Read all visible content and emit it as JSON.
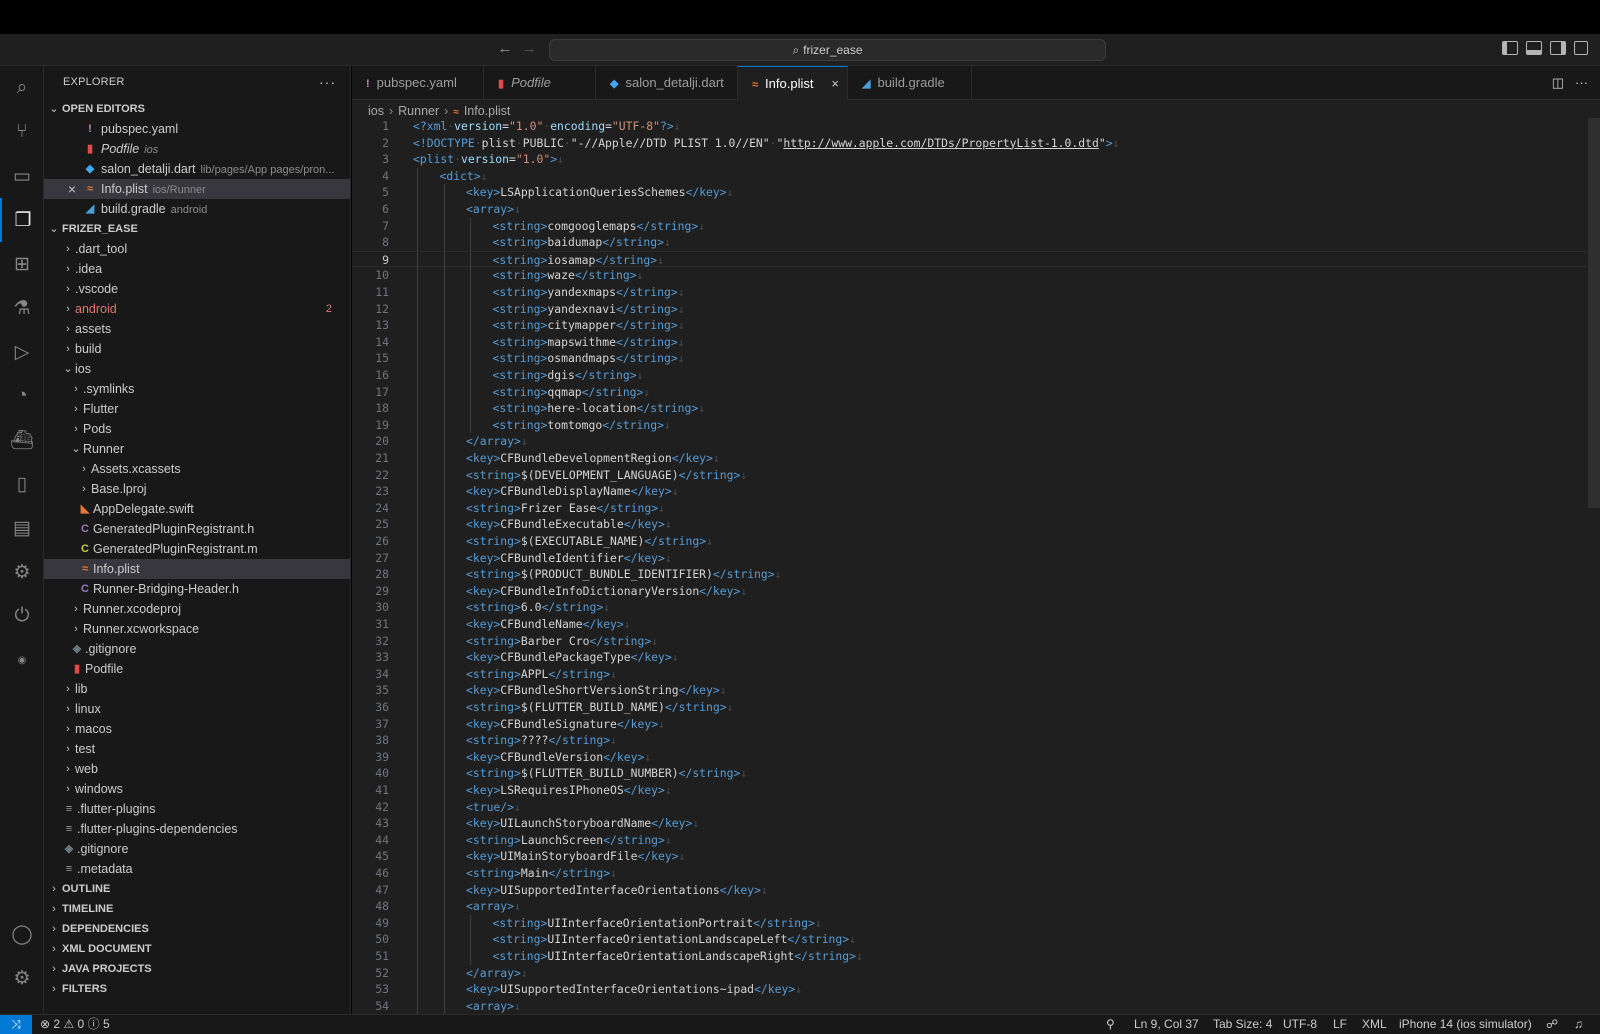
{
  "titlebar": {
    "search_text": "frizer_ease"
  },
  "explorer": {
    "title": "EXPLORER",
    "open_editors_label": "OPEN EDITORS",
    "open_editors": [
      {
        "name": "pubspec.yaml",
        "desc": "",
        "icon": "!",
        "icon_color": "#c586c0",
        "italic": false
      },
      {
        "name": "Podfile",
        "desc": "ios",
        "icon": "▮",
        "icon_color": "#e14b4b",
        "italic": true
      },
      {
        "name": "salon_detalji.dart",
        "desc": "lib/pages/App pages/pron...",
        "icon": "◆",
        "icon_color": "#42a5f5",
        "italic": false
      },
      {
        "name": "Info.plist",
        "desc": "ios/Runner",
        "icon": "≈",
        "icon_color": "#e37933",
        "italic": false
      },
      {
        "name": "build.gradle",
        "desc": "android",
        "icon": "◢",
        "icon_color": "#4a9fd4",
        "italic": false
      }
    ],
    "project_label": "FRIZER_EASE",
    "tree": [
      {
        "name": ".dart_tool",
        "type": "folder",
        "depth": 0,
        "open": false
      },
      {
        "name": ".idea",
        "type": "folder",
        "depth": 0,
        "open": false
      },
      {
        "name": ".vscode",
        "type": "folder",
        "depth": 0,
        "open": false
      },
      {
        "name": "android",
        "type": "folder",
        "depth": 0,
        "open": false,
        "badge": "2",
        "error": true
      },
      {
        "name": "assets",
        "type": "folder",
        "depth": 0,
        "open": false
      },
      {
        "name": "build",
        "type": "folder",
        "depth": 0,
        "open": false
      },
      {
        "name": "ios",
        "type": "folder",
        "depth": 0,
        "open": true
      },
      {
        "name": ".symlinks",
        "type": "folder",
        "depth": 1,
        "open": false
      },
      {
        "name": "Flutter",
        "type": "folder",
        "depth": 1,
        "open": false
      },
      {
        "name": "Pods",
        "type": "folder",
        "depth": 1,
        "open": false
      },
      {
        "name": "Runner",
        "type": "folder",
        "depth": 1,
        "open": true
      },
      {
        "name": "Assets.xcassets",
        "type": "folder",
        "depth": 2,
        "open": false
      },
      {
        "name": "Base.lproj",
        "type": "folder",
        "depth": 2,
        "open": false
      },
      {
        "name": "AppDelegate.swift",
        "type": "file",
        "depth": 2,
        "icon": "◣",
        "icon_color": "#e37933"
      },
      {
        "name": "GeneratedPluginRegistrant.h",
        "type": "file",
        "depth": 2,
        "icon": "C",
        "icon_color": "#a074c4"
      },
      {
        "name": "GeneratedPluginRegistrant.m",
        "type": "file",
        "depth": 2,
        "icon": "C",
        "icon_color": "#cbcb41"
      },
      {
        "name": "Info.plist",
        "type": "file",
        "depth": 2,
        "icon": "≈",
        "icon_color": "#e37933",
        "selected": true
      },
      {
        "name": "Runner-Bridging-Header.h",
        "type": "file",
        "depth": 2,
        "icon": "C",
        "icon_color": "#a074c4"
      },
      {
        "name": "Runner.xcodeproj",
        "type": "folder",
        "depth": 1,
        "open": false
      },
      {
        "name": "Runner.xcworkspace",
        "type": "folder",
        "depth": 1,
        "open": false
      },
      {
        "name": ".gitignore",
        "type": "file",
        "depth": 1,
        "icon": "◈",
        "icon_color": "#6d8086"
      },
      {
        "name": "Podfile",
        "type": "file",
        "depth": 1,
        "icon": "▮",
        "icon_color": "#e14b4b"
      },
      {
        "name": "lib",
        "type": "folder",
        "depth": 0,
        "open": false
      },
      {
        "name": "linux",
        "type": "folder",
        "depth": 0,
        "open": false
      },
      {
        "name": "macos",
        "type": "folder",
        "depth": 0,
        "open": false
      },
      {
        "name": "test",
        "type": "folder",
        "depth": 0,
        "open": false
      },
      {
        "name": "web",
        "type": "folder",
        "depth": 0,
        "open": false
      },
      {
        "name": "windows",
        "type": "folder",
        "depth": 0,
        "open": false
      },
      {
        "name": ".flutter-plugins",
        "type": "file",
        "depth": 0,
        "icon": "≡",
        "icon_color": "#9d9d9d"
      },
      {
        "name": ".flutter-plugins-dependencies",
        "type": "file",
        "depth": 0,
        "icon": "≡",
        "icon_color": "#9d9d9d"
      },
      {
        "name": ".gitignore",
        "type": "file",
        "depth": 0,
        "icon": "◈",
        "icon_color": "#6d8086"
      },
      {
        "name": ".metadata",
        "type": "file",
        "depth": 0,
        "icon": "≡",
        "icon_color": "#9d9d9d"
      }
    ],
    "sections": [
      "OUTLINE",
      "TIMELINE",
      "DEPENDENCIES",
      "XML DOCUMENT",
      "JAVA PROJECTS",
      "FILTERS"
    ]
  },
  "tabs": [
    {
      "label": "pubspec.yaml",
      "icon": "!",
      "icon_color": "#c586c0",
      "active": false,
      "italic": false
    },
    {
      "label": "Podfile",
      "icon": "▮",
      "icon_color": "#e14b4b",
      "active": false,
      "italic": true
    },
    {
      "label": "salon_detalji.dart",
      "icon": "◆",
      "icon_color": "#42a5f5",
      "active": false,
      "italic": false
    },
    {
      "label": "Info.plist",
      "icon": "≈",
      "icon_color": "#e37933",
      "active": true,
      "italic": false
    },
    {
      "label": "build.gradle",
      "icon": "◢",
      "icon_color": "#4a9fd4",
      "active": false,
      "italic": false
    }
  ],
  "breadcrumb": [
    "ios",
    "Runner",
    "Info.plist"
  ],
  "editor": {
    "current_line": 9,
    "lines": [
      {
        "n": "1",
        "indent": 0,
        "kind": "xmldecl"
      },
      {
        "n": "2",
        "indent": 0,
        "kind": "doctype",
        "public_id": "\"-//Apple//DTD PLIST 1.0//EN\"",
        "system_id": "http://www.apple.com/DTDs/PropertyList-1.0.dtd"
      },
      {
        "n": "3",
        "indent": 0,
        "kind": "plist"
      },
      {
        "n": "4",
        "indent": 1,
        "kind": "open",
        "tag": "dict"
      },
      {
        "n": "5",
        "indent": 2,
        "kind": "elem",
        "tag": "key",
        "text": "LSApplicationQueriesSchemes"
      },
      {
        "n": "6",
        "indent": 2,
        "kind": "open",
        "tag": "array"
      },
      {
        "n": "7",
        "indent": 3,
        "kind": "elem",
        "tag": "string",
        "text": "comgooglemaps"
      },
      {
        "n": "8",
        "indent": 3,
        "kind": "elem",
        "tag": "string",
        "text": "baidumap"
      },
      {
        "n": "9",
        "indent": 3,
        "kind": "elem",
        "tag": "string",
        "text": "iosamap"
      },
      {
        "n": "10",
        "indent": 3,
        "kind": "elem",
        "tag": "string",
        "text": "waze"
      },
      {
        "n": "11",
        "indent": 3,
        "kind": "elem",
        "tag": "string",
        "text": "yandexmaps"
      },
      {
        "n": "12",
        "indent": 3,
        "kind": "elem",
        "tag": "string",
        "text": "yandexnavi"
      },
      {
        "n": "13",
        "indent": 3,
        "kind": "elem",
        "tag": "string",
        "text": "citymapper"
      },
      {
        "n": "14",
        "indent": 3,
        "kind": "elem",
        "tag": "string",
        "text": "mapswithme"
      },
      {
        "n": "15",
        "indent": 3,
        "kind": "elem",
        "tag": "string",
        "text": "osmandmaps"
      },
      {
        "n": "16",
        "indent": 3,
        "kind": "elem",
        "tag": "string",
        "text": "dgis"
      },
      {
        "n": "17",
        "indent": 3,
        "kind": "elem",
        "tag": "string",
        "text": "qqmap"
      },
      {
        "n": "18",
        "indent": 3,
        "kind": "elem",
        "tag": "string",
        "text": "here-location"
      },
      {
        "n": "19",
        "indent": 3,
        "kind": "elem",
        "tag": "string",
        "text": "tomtomgo"
      },
      {
        "n": "20",
        "indent": 2,
        "kind": "close",
        "tag": "array"
      },
      {
        "n": "21",
        "indent": 2,
        "kind": "elem",
        "tag": "key",
        "text": "CFBundleDevelopmentRegion"
      },
      {
        "n": "22",
        "indent": 2,
        "kind": "elem",
        "tag": "string",
        "text": "$(DEVELOPMENT_LANGUAGE)"
      },
      {
        "n": "23",
        "indent": 2,
        "kind": "elem",
        "tag": "key",
        "text": "CFBundleDisplayName"
      },
      {
        "n": "24",
        "indent": 2,
        "kind": "elem",
        "tag": "string",
        "text": "Frizer Ease"
      },
      {
        "n": "25",
        "indent": 2,
        "kind": "elem",
        "tag": "key",
        "text": "CFBundleExecutable"
      },
      {
        "n": "26",
        "indent": 2,
        "kind": "elem",
        "tag": "string",
        "text": "$(EXECUTABLE_NAME)"
      },
      {
        "n": "27",
        "indent": 2,
        "kind": "elem",
        "tag": "key",
        "text": "CFBundleIdentifier"
      },
      {
        "n": "28",
        "indent": 2,
        "kind": "elem",
        "tag": "string",
        "text": "$(PRODUCT_BUNDLE_IDENTIFIER)"
      },
      {
        "n": "29",
        "indent": 2,
        "kind": "elem",
        "tag": "key",
        "text": "CFBundleInfoDictionaryVersion"
      },
      {
        "n": "30",
        "indent": 2,
        "kind": "elem",
        "tag": "string",
        "text": "6.0"
      },
      {
        "n": "31",
        "indent": 2,
        "kind": "elem",
        "tag": "key",
        "text": "CFBundleName"
      },
      {
        "n": "32",
        "indent": 2,
        "kind": "elem",
        "tag": "string",
        "text": "Barber Cro"
      },
      {
        "n": "33",
        "indent": 2,
        "kind": "elem",
        "tag": "key",
        "text": "CFBundlePackageType"
      },
      {
        "n": "34",
        "indent": 2,
        "kind": "elem",
        "tag": "string",
        "text": "APPL"
      },
      {
        "n": "35",
        "indent": 2,
        "kind": "elem",
        "tag": "key",
        "text": "CFBundleShortVersionString"
      },
      {
        "n": "36",
        "indent": 2,
        "kind": "elem",
        "tag": "string",
        "text": "$(FLUTTER_BUILD_NAME)"
      },
      {
        "n": "37",
        "indent": 2,
        "kind": "elem",
        "tag": "key",
        "text": "CFBundleSignature"
      },
      {
        "n": "38",
        "indent": 2,
        "kind": "elem",
        "tag": "string",
        "text": "????"
      },
      {
        "n": "39",
        "indent": 2,
        "kind": "elem",
        "tag": "key",
        "text": "CFBundleVersion"
      },
      {
        "n": "40",
        "indent": 2,
        "kind": "elem",
        "tag": "string",
        "text": "$(FLUTTER_BUILD_NUMBER)"
      },
      {
        "n": "41",
        "indent": 2,
        "kind": "elem",
        "tag": "key",
        "text": "LSRequiresIPhoneOS"
      },
      {
        "n": "42",
        "indent": 2,
        "kind": "selfclose",
        "tag": "true"
      },
      {
        "n": "43",
        "indent": 2,
        "kind": "elem",
        "tag": "key",
        "text": "UILaunchStoryboardName"
      },
      {
        "n": "44",
        "indent": 2,
        "kind": "elem",
        "tag": "string",
        "text": "LaunchScreen"
      },
      {
        "n": "45",
        "indent": 2,
        "kind": "elem",
        "tag": "key",
        "text": "UIMainStoryboardFile"
      },
      {
        "n": "46",
        "indent": 2,
        "kind": "elem",
        "tag": "string",
        "text": "Main"
      },
      {
        "n": "47",
        "indent": 2,
        "kind": "elem",
        "tag": "key",
        "text": "UISupportedInterfaceOrientations"
      },
      {
        "n": "48",
        "indent": 2,
        "kind": "open",
        "tag": "array"
      },
      {
        "n": "49",
        "indent": 3,
        "kind": "elem",
        "tag": "string",
        "text": "UIInterfaceOrientationPortrait"
      },
      {
        "n": "50",
        "indent": 3,
        "kind": "elem",
        "tag": "string",
        "text": "UIInterfaceOrientationLandscapeLeft"
      },
      {
        "n": "51",
        "indent": 3,
        "kind": "elem",
        "tag": "string",
        "text": "UIInterfaceOrientationLandscapeRight"
      },
      {
        "n": "52",
        "indent": 2,
        "kind": "close",
        "tag": "array"
      },
      {
        "n": "53",
        "indent": 2,
        "kind": "elem",
        "tag": "key",
        "text": "UISupportedInterfaceOrientations~ipad"
      },
      {
        "n": "54",
        "indent": 2,
        "kind": "open",
        "tag": "array"
      }
    ]
  },
  "statusbar": {
    "errors": "2",
    "warnings": "0",
    "infos": "5",
    "position": "Ln 9, Col 37",
    "tab_size": "Tab Size: 4",
    "encoding": "UTF-8",
    "eol": "LF",
    "language": "XML",
    "device": "iPhone 14 (ios simulator)"
  }
}
